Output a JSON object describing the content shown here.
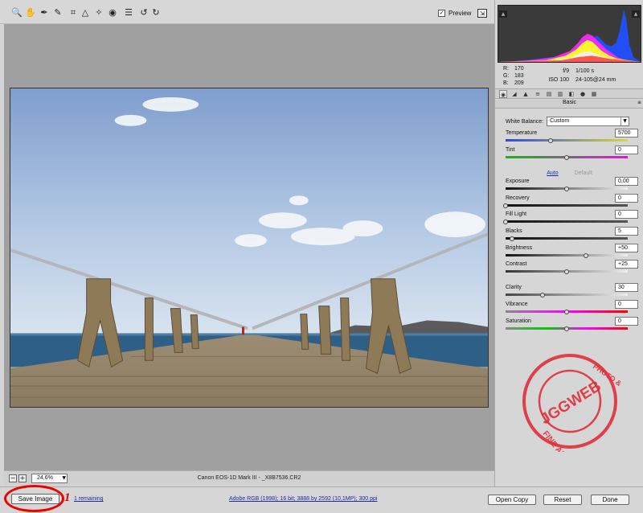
{
  "toolbar": {
    "tools": [
      {
        "name": "zoom-tool-icon",
        "glyph": "🔍"
      },
      {
        "name": "hand-tool-icon",
        "glyph": "✋"
      },
      {
        "name": "white-balance-tool-icon",
        "glyph": "✒"
      },
      {
        "name": "color-sampler-tool-icon",
        "glyph": "✎"
      },
      {
        "name": "crop-tool-icon",
        "glyph": "⌗"
      },
      {
        "name": "straighten-tool-icon",
        "glyph": "△"
      },
      {
        "name": "retouch-tool-icon",
        "glyph": "✧"
      },
      {
        "name": "red-eye-tool-icon",
        "glyph": "◉"
      },
      {
        "name": "preferences-icon",
        "glyph": "☰"
      },
      {
        "name": "rotate-left-icon",
        "glyph": "↺"
      },
      {
        "name": "rotate-right-icon",
        "glyph": "↻"
      }
    ],
    "preview_label": "Preview",
    "preview_checked": true
  },
  "canvas": {
    "zoom": "24,6%",
    "file_info": "Canon EOS-1D Mark III  -  _X8B7536.CR2"
  },
  "readout": {
    "r_label": "R:",
    "r": "170",
    "g_label": "G:",
    "g": "183",
    "b_label": "B:",
    "b": "209",
    "aperture": "f/9",
    "shutter": "1/100 s",
    "iso": "ISO 100",
    "lens": "24-105@24 mm"
  },
  "panel": {
    "section_title": "Basic",
    "white_balance_label": "White Balance:",
    "white_balance_value": "Custom",
    "auto_label": "Auto",
    "default_label": "Default",
    "sliders": [
      {
        "label": "Temperature",
        "value": "5700",
        "position": 0.37
      },
      {
        "label": "Tint",
        "value": "0",
        "position": 0.5
      },
      {
        "label": "Exposure",
        "value": "0,00",
        "position": 0.5
      },
      {
        "label": "Recovery",
        "value": "0",
        "position": 0.0
      },
      {
        "label": "Fill Light",
        "value": "0",
        "position": 0.0
      },
      {
        "label": "Blacks",
        "value": "5",
        "position": 0.05
      },
      {
        "label": "Brightness",
        "value": "+50",
        "position": 0.66
      },
      {
        "label": "Contrast",
        "value": "+25",
        "position": 0.5
      },
      {
        "label": "Clarity",
        "value": "30",
        "position": 0.3
      },
      {
        "label": "Vibrance",
        "value": "0",
        "position": 0.5
      },
      {
        "label": "Saturation",
        "value": "0",
        "position": 0.5
      }
    ]
  },
  "bottom": {
    "save_label": "Save Image",
    "remaining_label": "1 remaining",
    "annotation": "1",
    "workflow_link": "Adobe RGB (1998); 16 bit; 3888 by 2592 (10,1MP); 300 ppi",
    "open_label": "Open Copy",
    "reset_label": "Reset",
    "done_label": "Done"
  },
  "colors": {
    "accent_link": "#1a2bb0",
    "annotation_red": "#e00000",
    "sky": "#a9c0de"
  }
}
